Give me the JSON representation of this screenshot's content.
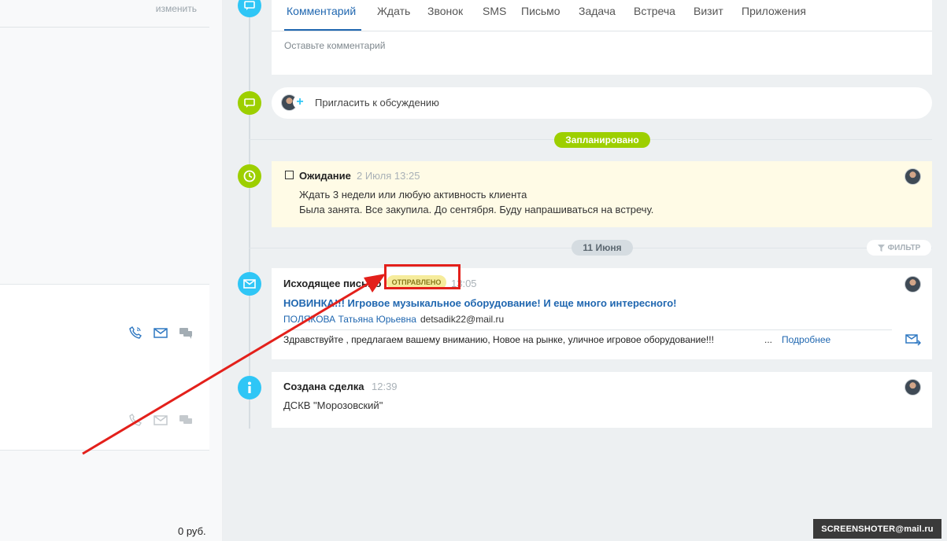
{
  "left": {
    "change_link": "изменить",
    "sum": "0 руб."
  },
  "composer": {
    "tabs": [
      "Комментарий",
      "Ждать",
      "Звонок",
      "SMS",
      "Письмо",
      "Задача",
      "Встреча",
      "Визит",
      "Приложения"
    ],
    "active_tab": "Комментарий",
    "placeholder": "Оставьте комментарий"
  },
  "invite": {
    "label": "Пригласить к обсуждению"
  },
  "planned": {
    "header": "Запланировано",
    "title": "Ожидание",
    "date": "2 Июля 13:25",
    "line1": "Ждать 3 недели или любую активность клиента",
    "line2": "Была занята. Все закупила. До сентября. Буду напрашиваться на встречу."
  },
  "day_separator": "11 Июня",
  "filter_label": "ФИЛЬТР",
  "email": {
    "title": "Исходящее письмо",
    "status": "ОТПРАВЛЕНО",
    "time": "13:05",
    "subject": "НОВИНКА!!! Игровое музыкальное оборудование! И еще много интересного!",
    "contact_name": "ПОЛЯКОВА Татьяна Юрьевна",
    "contact_email": "detsadik22@mail.ru",
    "preview": "Здравствуйте , предлагаем вашему вниманию, Новое на рынке,  уличное игровое оборудование!!!",
    "ellipsis": "...",
    "more_link": "Подробнее"
  },
  "deal": {
    "title": "Создана сделка",
    "time": "12:39",
    "text": "ДСКВ \"Морозовский\""
  },
  "watermark": "SCREENSHOTER@mail.ru",
  "colors": {
    "accent_blue": "#2067b0",
    "green": "#9dcf00",
    "light_blue": "#2fc6f6",
    "annotation_red": "#e3201b",
    "planned_bg": "#fffbe6"
  }
}
